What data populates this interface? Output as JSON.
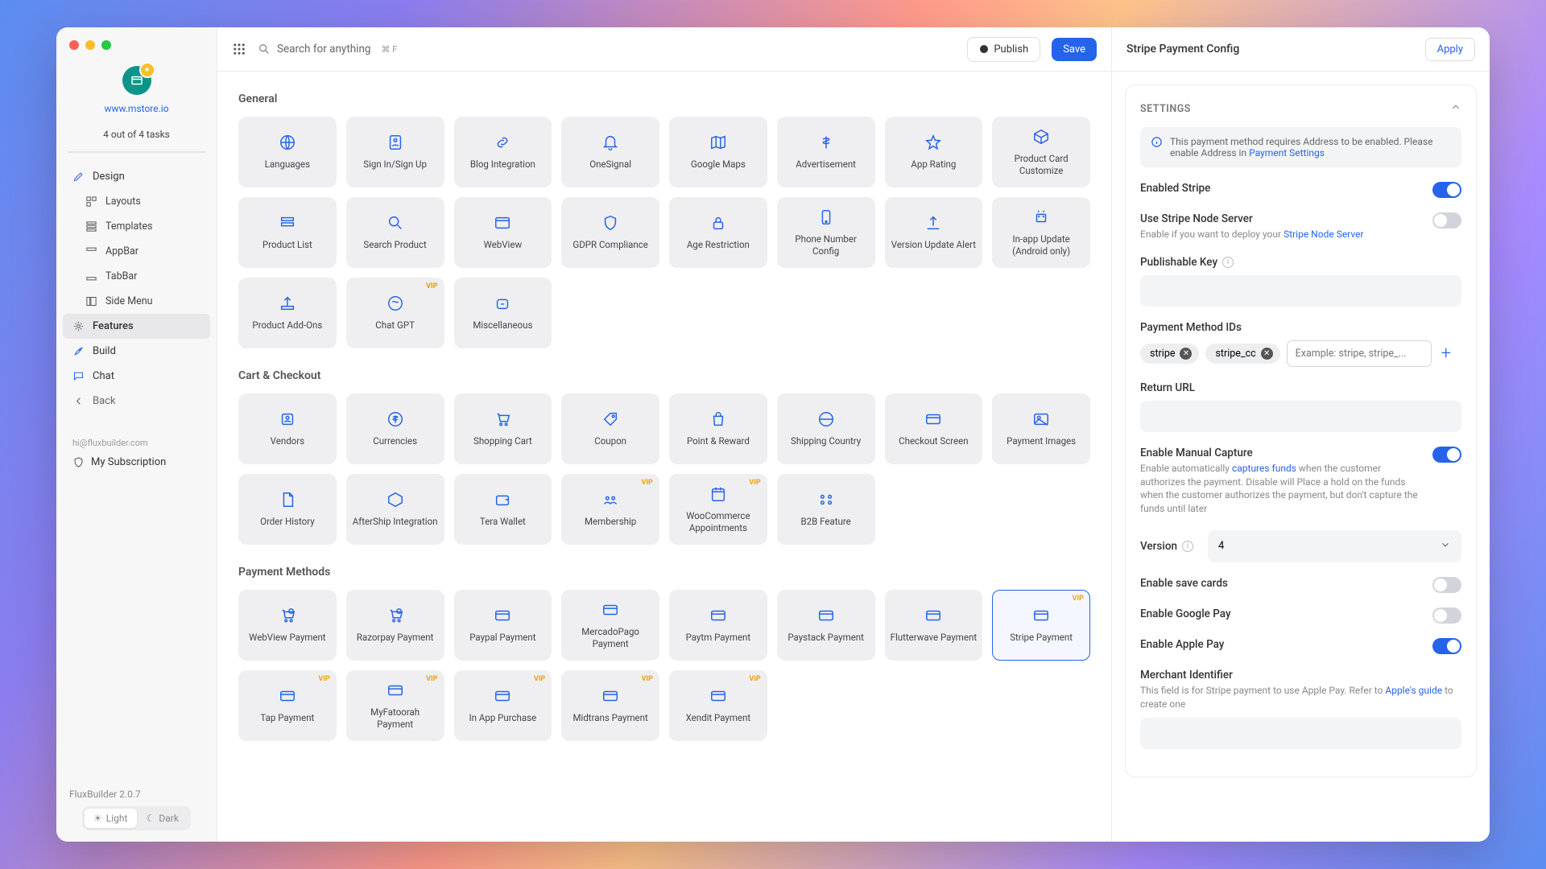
{
  "sidebar": {
    "site_url": "www.mstore.io",
    "tasks": "4 out of 4 tasks",
    "items": [
      {
        "label": "Design"
      },
      {
        "label": "Layouts"
      },
      {
        "label": "Templates"
      },
      {
        "label": "AppBar"
      },
      {
        "label": "TabBar"
      },
      {
        "label": "Side Menu"
      },
      {
        "label": "Features"
      },
      {
        "label": "Build"
      },
      {
        "label": "Chat"
      },
      {
        "label": "Back"
      }
    ],
    "email": "hi@fluxbuilder.com",
    "subscription": "My Subscription",
    "version": "FluxBuilder 2.0.7",
    "theme_light": "Light",
    "theme_dark": "Dark"
  },
  "topbar": {
    "search_placeholder": "Search for anything",
    "search_kbd": "⌘ F",
    "publish": "Publish",
    "save": "Save"
  },
  "sections": {
    "general": {
      "title": "General",
      "tiles": [
        "Languages",
        "Sign In/Sign Up",
        "Blog Integration",
        "OneSignal",
        "Google Maps",
        "Advertisement",
        "App Rating",
        "Product Card Customize",
        "Product List",
        "Search Product",
        "WebView",
        "GDPR Compliance",
        "Age Restriction",
        "Phone Number Config",
        "Version Update Alert",
        "In-app Update (Android only)",
        "Product Add-Ons",
        "Chat GPT",
        "Miscellaneous"
      ],
      "vip": {
        "16": false,
        "17": true
      }
    },
    "cart": {
      "title": "Cart & Checkout",
      "tiles": [
        "Vendors",
        "Currencies",
        "Shopping Cart",
        "Coupon",
        "Point & Reward",
        "Shipping Country",
        "Checkout Screen",
        "Payment Images",
        "Order History",
        "AfterShip Integration",
        "Tera Wallet",
        "Membership",
        "WooCommerce Appointments",
        "B2B Feature"
      ],
      "vip": {
        "11": true,
        "12": true
      }
    },
    "payment": {
      "title": "Payment Methods",
      "tiles": [
        "WebView Payment",
        "Razorpay Payment",
        "Paypal Payment",
        "MercadoPago Payment",
        "Paytm Payment",
        "Paystack Payment",
        "Flutterwave Payment",
        "Stripe Payment",
        "Tap Payment",
        "MyFatoorah Payment",
        "In App Purchase",
        "Midtrans Payment",
        "Xendit Payment"
      ],
      "vip": {
        "7": true,
        "8": true,
        "9": true,
        "10": true,
        "11": true,
        "12": true
      },
      "selected": 7
    }
  },
  "rightpanel": {
    "title": "Stripe Payment Config",
    "apply": "Apply",
    "settings_head": "SETTINGS",
    "info_text": "This payment method requires Address to be enabled. Please enable Address in ",
    "info_link": "Payment Settings",
    "enabled_stripe": "Enabled Stripe",
    "use_node": "Use Stripe Node Server",
    "use_node_desc": "Enable if you want to deploy your ",
    "use_node_link": "Stripe Node Server",
    "pub_key": "Publishable Key",
    "pm_ids": "Payment Method IDs",
    "chips": [
      "stripe",
      "stripe_cc"
    ],
    "chip_placeholder": "Example: stripe, stripe_...",
    "return_url": "Return URL",
    "manual_capture": "Enable Manual Capture",
    "manual_capture_desc_a": "Enable automatically ",
    "manual_capture_link": "captures funds",
    "manual_capture_desc_b": " when the customer authorizes the payment. Disable will Place a hold on the funds when the customer authorizes the payment, but don't capture the funds until later",
    "version_label": "Version",
    "version_value": "4",
    "save_cards": "Enable save cards",
    "google_pay": "Enable Google Pay",
    "apple_pay": "Enable Apple Pay",
    "merchant_id": "Merchant Identifier",
    "merchant_desc_a": "This field is for Stripe payment to use Apple Pay. Refer to ",
    "merchant_link": "Apple's guide",
    "merchant_desc_b": " to create one"
  }
}
